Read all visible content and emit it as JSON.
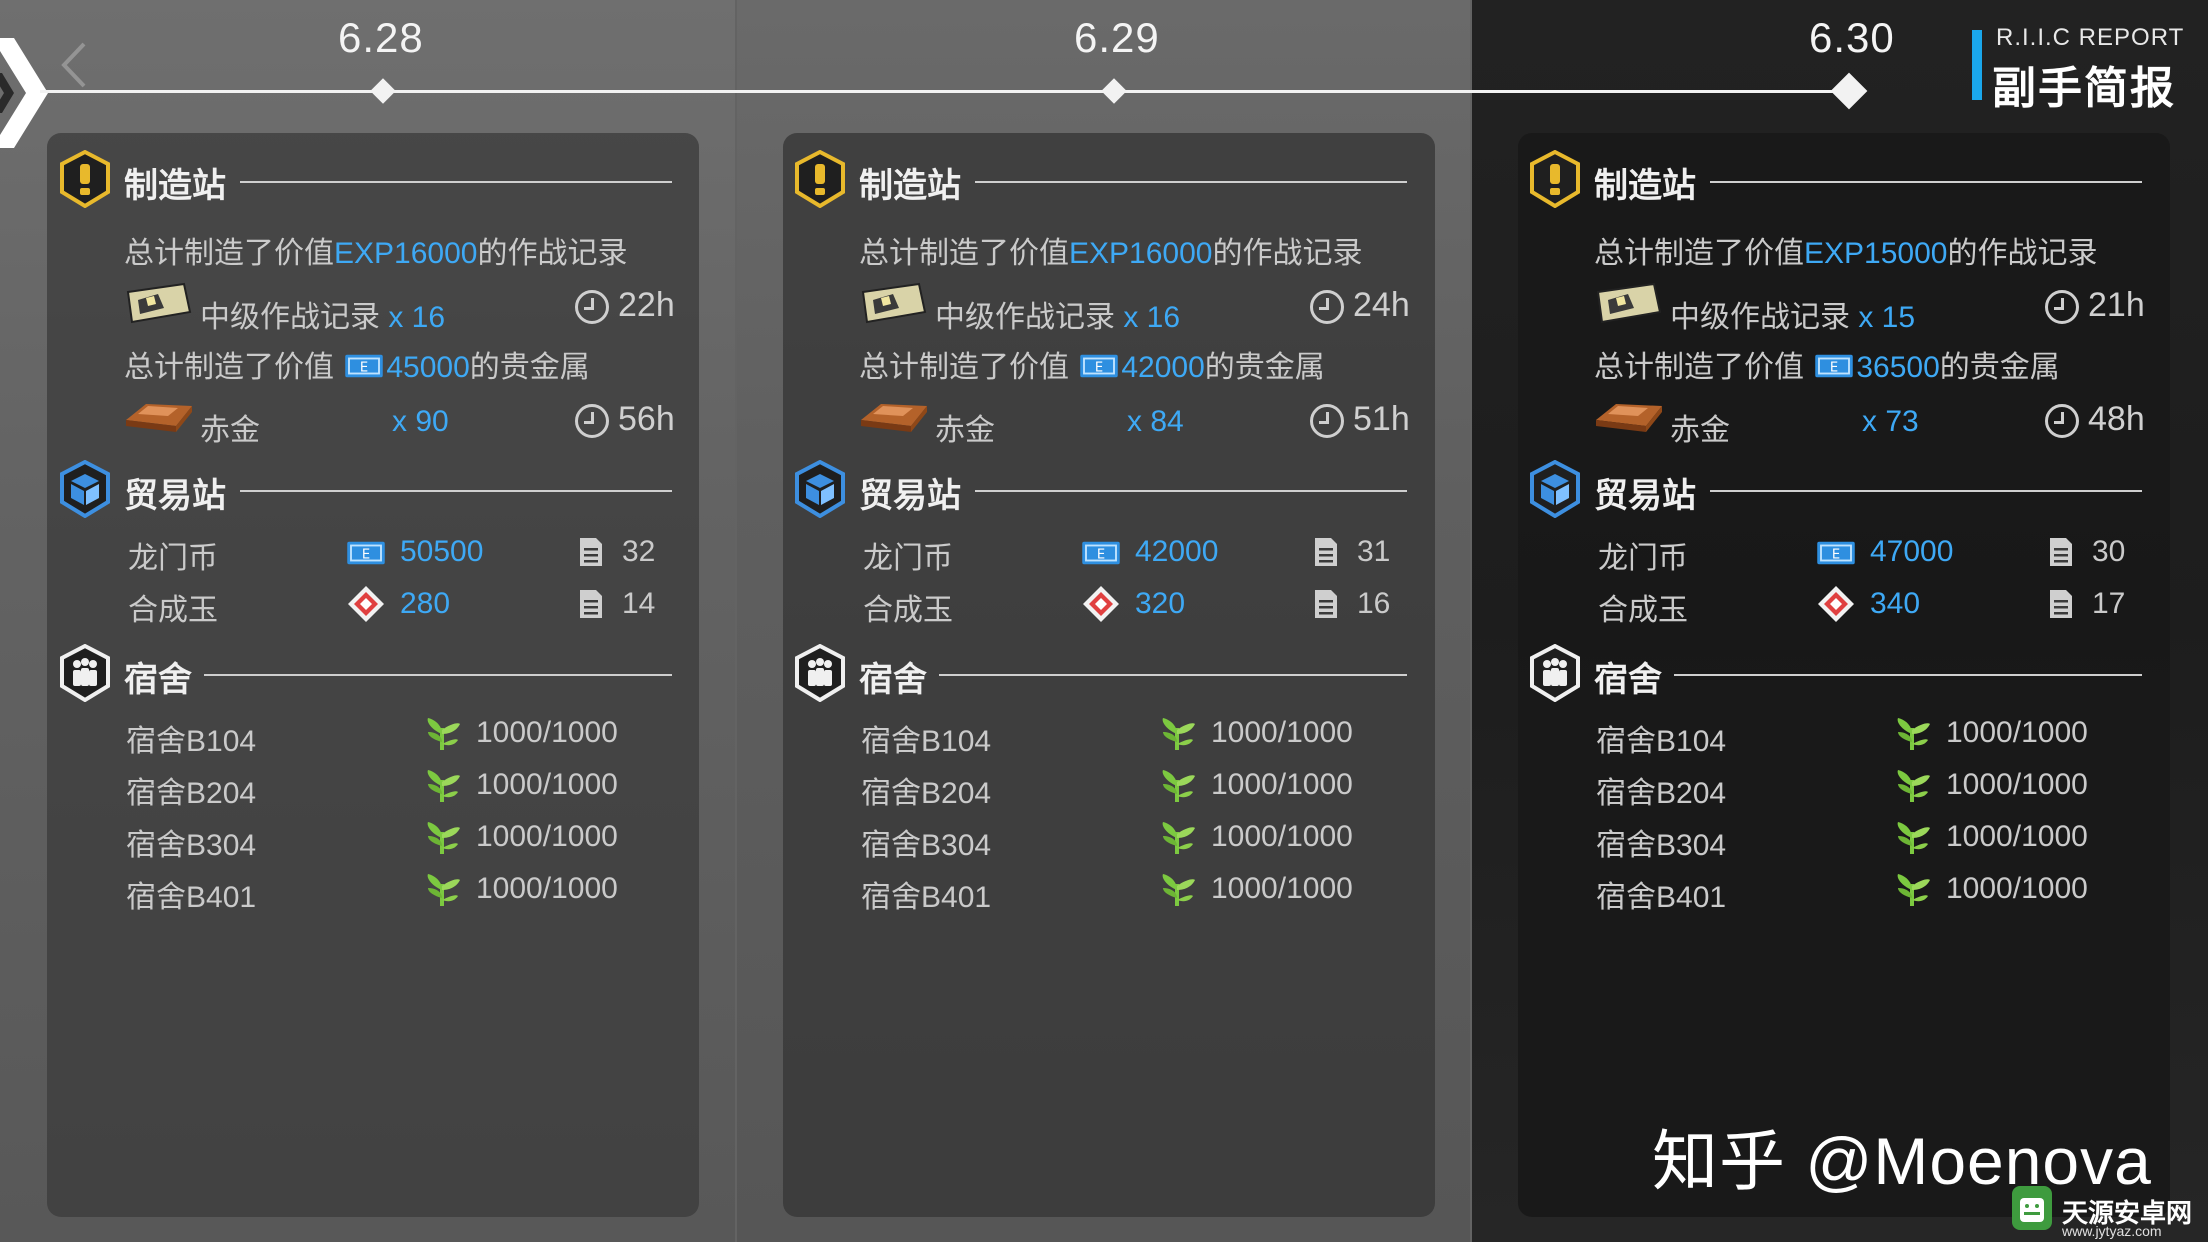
{
  "header": {
    "report_en": "R.I.I.C REPORT",
    "report_cn": "副手简报"
  },
  "columns": [
    {
      "date": "6.28",
      "manufacturing": {
        "title": "制造站",
        "exp_prefix": "总计制造了价值",
        "exp_value": "EXP16000",
        "exp_suffix": "的作战记录",
        "record_name": "中级作战记录",
        "record_count": "x 16",
        "record_hours": "22h",
        "gold_prefix": "总计制造了价值",
        "gold_value": "45000",
        "gold_suffix": "的贵金属",
        "gold_name": "赤金",
        "gold_count": "x 90",
        "gold_hours": "56h"
      },
      "trading": {
        "title": "贸易站",
        "lmd_label": "龙门币",
        "lmd_value": "50500",
        "lmd_orders": "32",
        "orundum_label": "合成玉",
        "orundum_value": "280",
        "orundum_orders": "14"
      },
      "dorm": {
        "title": "宿舍",
        "rooms": [
          {
            "name": "宿舍B104",
            "value": "1000/1000"
          },
          {
            "name": "宿舍B204",
            "value": "1000/1000"
          },
          {
            "name": "宿舍B304",
            "value": "1000/1000"
          },
          {
            "name": "宿舍B401",
            "value": "1000/1000"
          }
        ]
      }
    },
    {
      "date": "6.29",
      "manufacturing": {
        "title": "制造站",
        "exp_prefix": "总计制造了价值",
        "exp_value": "EXP16000",
        "exp_suffix": "的作战记录",
        "record_name": "中级作战记录",
        "record_count": "x 16",
        "record_hours": "24h",
        "gold_prefix": "总计制造了价值",
        "gold_value": "42000",
        "gold_suffix": "的贵金属",
        "gold_name": "赤金",
        "gold_count": "x 84",
        "gold_hours": "51h"
      },
      "trading": {
        "title": "贸易站",
        "lmd_label": "龙门币",
        "lmd_value": "42000",
        "lmd_orders": "31",
        "orundum_label": "合成玉",
        "orundum_value": "320",
        "orundum_orders": "16"
      },
      "dorm": {
        "title": "宿舍",
        "rooms": [
          {
            "name": "宿舍B104",
            "value": "1000/1000"
          },
          {
            "name": "宿舍B204",
            "value": "1000/1000"
          },
          {
            "name": "宿舍B304",
            "value": "1000/1000"
          },
          {
            "name": "宿舍B401",
            "value": "1000/1000"
          }
        ]
      }
    },
    {
      "date": "6.30",
      "manufacturing": {
        "title": "制造站",
        "exp_prefix": "总计制造了价值",
        "exp_value": "EXP15000",
        "exp_suffix": "的作战记录",
        "record_name": "中级作战记录",
        "record_count": "x 15",
        "record_hours": "21h",
        "gold_prefix": "总计制造了价值",
        "gold_value": "36500",
        "gold_suffix": "的贵金属",
        "gold_name": "赤金",
        "gold_count": "x 73",
        "gold_hours": "48h"
      },
      "trading": {
        "title": "贸易站",
        "lmd_label": "龙门币",
        "lmd_value": "47000",
        "lmd_orders": "30",
        "orundum_label": "合成玉",
        "orundum_value": "340",
        "orundum_orders": "17"
      },
      "dorm": {
        "title": "宿舍",
        "rooms": [
          {
            "name": "宿舍B104",
            "value": "1000/1000"
          },
          {
            "name": "宿舍B204",
            "value": "1000/1000"
          },
          {
            "name": "宿舍B304",
            "value": "1000/1000"
          },
          {
            "name": "宿舍B401",
            "value": "1000/1000"
          }
        ]
      }
    }
  ],
  "watermark": "知乎 @Moenova",
  "site": {
    "name": "天源安卓网",
    "url": "www.jytyaz.com"
  },
  "colors": {
    "accent_blue": "#3ea9f5",
    "report_bar": "#1aa7ec",
    "manufacturing_icon": "#e8b92c",
    "trading_icon": "#3d8fe0",
    "leaf_green": "#7cc940"
  }
}
